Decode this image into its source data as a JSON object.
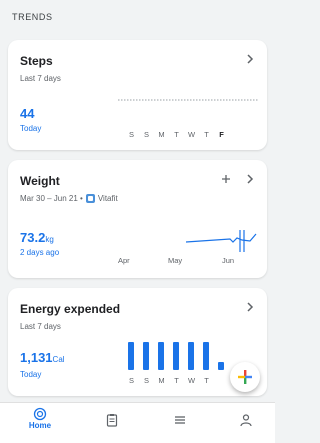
{
  "section": {
    "title": "TRENDS"
  },
  "steps": {
    "title": "Steps",
    "subtitle": "Last 7 days",
    "value": "44",
    "value_label": "Today",
    "days": [
      "S",
      "S",
      "M",
      "T",
      "W",
      "T",
      "F"
    ]
  },
  "weight": {
    "title": "Weight",
    "date_range": "Mar 30 – Jun 21 •",
    "source": "Vitafit",
    "value": "73.2",
    "unit": "kg",
    "value_label": "2 days ago",
    "months": [
      "Apr",
      "May",
      "Jun"
    ]
  },
  "energy": {
    "title": "Energy expended",
    "subtitle": "Last 7 days",
    "value": "1,131",
    "unit": "Cal",
    "value_label": "Today",
    "days": [
      "S",
      "S",
      "M",
      "T",
      "W",
      "T"
    ],
    "bar_levels": [
      1.0,
      1.0,
      1.0,
      1.0,
      1.0,
      1.0,
      0.3
    ]
  },
  "nav": {
    "home_label": "Home"
  },
  "colors": {
    "accent": "#1a73e8"
  }
}
